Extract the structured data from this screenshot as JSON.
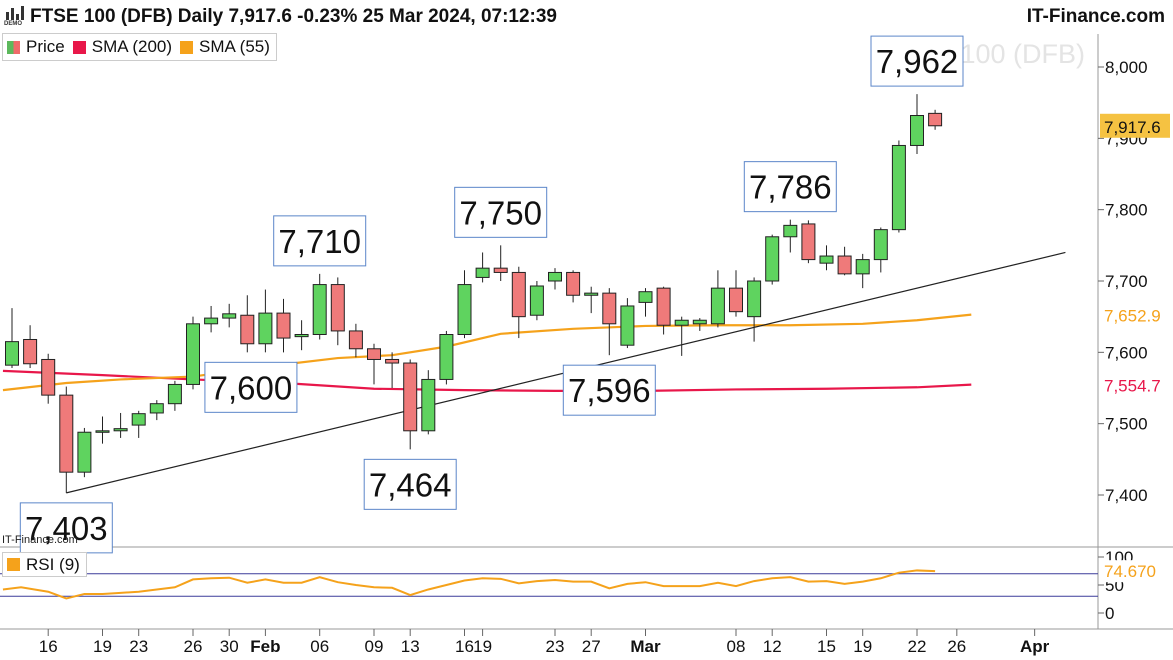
{
  "header": {
    "title": "FTSE 100 (DFB) Daily 7,917.6 -0.23% 25 Mar 2024, 07:12:39",
    "brand": "IT-Finance.com",
    "logo_text": "DEMO"
  },
  "legend": {
    "items": [
      {
        "label": "Price",
        "color": "#5cb85c"
      },
      {
        "label": "SMA (200)",
        "color": "#e8174a"
      },
      {
        "label": "SMA (55)",
        "color": "#f5a21b"
      }
    ]
  },
  "rsi_legend": {
    "label": "RSI (9)",
    "color": "#f5a21b"
  },
  "credit": "IT-Finance.com",
  "colors": {
    "up": "#5fd35f",
    "down": "#ef7a7a",
    "sma200": "#e8174a",
    "sma55": "#f5a21b",
    "rsi": "#f5a21b",
    "trend": "#222222",
    "box_border": "#5b86c9",
    "price_tag": "#f5c242"
  },
  "chart_data": [
    {
      "type": "candlestick",
      "title": "FTSE 100 (DFB)",
      "ylim": [
        7310,
        8050
      ],
      "y_ticks": [
        "7,400",
        "7,500",
        "7,600",
        "7,700",
        "7,800",
        "7,900",
        "8,000"
      ],
      "x_labels": [
        {
          "label": "16",
          "index": 2
        },
        {
          "label": "19",
          "index": 5
        },
        {
          "label": "23",
          "index": 7
        },
        {
          "label": "26",
          "index": 10
        },
        {
          "label": "30",
          "index": 12
        },
        {
          "label": "Feb",
          "index": 14
        },
        {
          "label": "06",
          "index": 17
        },
        {
          "label": "09",
          "index": 20
        },
        {
          "label": "13",
          "index": 22
        },
        {
          "label": "16",
          "index": 25
        },
        {
          "label": "19",
          "index": 26
        },
        {
          "label": "23",
          "index": 30
        },
        {
          "label": "27",
          "index": 32
        },
        {
          "label": "Mar",
          "index": 35
        },
        {
          "label": "08",
          "index": 40
        },
        {
          "label": "12",
          "index": 42
        },
        {
          "label": "15",
          "index": 45
        },
        {
          "label": "19",
          "index": 47
        },
        {
          "label": "22",
          "index": 50
        },
        {
          "label": "26",
          "index": 52.2
        },
        {
          "label": "Apr",
          "index": 56.5
        }
      ],
      "candles": [
        {
          "o": 7582,
          "h": 7662,
          "l": 7578,
          "c": 7615
        },
        {
          "o": 7618,
          "h": 7638,
          "l": 7578,
          "c": 7584
        },
        {
          "o": 7590,
          "h": 7598,
          "l": 7528,
          "c": 7540
        },
        {
          "o": 7540,
          "h": 7552,
          "l": 7403,
          "c": 7432
        },
        {
          "o": 7432,
          "h": 7494,
          "l": 7425,
          "c": 7488
        },
        {
          "o": 7488,
          "h": 7510,
          "l": 7472,
          "c": 7490
        },
        {
          "o": 7490,
          "h": 7515,
          "l": 7480,
          "c": 7493
        },
        {
          "o": 7498,
          "h": 7518,
          "l": 7480,
          "c": 7514
        },
        {
          "o": 7515,
          "h": 7533,
          "l": 7505,
          "c": 7528
        },
        {
          "o": 7528,
          "h": 7560,
          "l": 7518,
          "c": 7555
        },
        {
          "o": 7555,
          "h": 7650,
          "l": 7548,
          "c": 7640
        },
        {
          "o": 7640,
          "h": 7665,
          "l": 7628,
          "c": 7648
        },
        {
          "o": 7648,
          "h": 7668,
          "l": 7635,
          "c": 7654
        },
        {
          "o": 7652,
          "h": 7680,
          "l": 7600,
          "c": 7612
        },
        {
          "o": 7612,
          "h": 7688,
          "l": 7600,
          "c": 7655
        },
        {
          "o": 7655,
          "h": 7675,
          "l": 7600,
          "c": 7620
        },
        {
          "o": 7622,
          "h": 7645,
          "l": 7603,
          "c": 7625
        },
        {
          "o": 7625,
          "h": 7710,
          "l": 7618,
          "c": 7695
        },
        {
          "o": 7695,
          "h": 7705,
          "l": 7610,
          "c": 7630
        },
        {
          "o": 7630,
          "h": 7640,
          "l": 7593,
          "c": 7605
        },
        {
          "o": 7605,
          "h": 7612,
          "l": 7555,
          "c": 7590
        },
        {
          "o": 7590,
          "h": 7600,
          "l": 7550,
          "c": 7585
        },
        {
          "o": 7585,
          "h": 7590,
          "l": 7464,
          "c": 7490
        },
        {
          "o": 7490,
          "h": 7575,
          "l": 7485,
          "c": 7562
        },
        {
          "o": 7562,
          "h": 7630,
          "l": 7555,
          "c": 7625
        },
        {
          "o": 7625,
          "h": 7715,
          "l": 7620,
          "c": 7695
        },
        {
          "o": 7705,
          "h": 7740,
          "l": 7698,
          "c": 7718
        },
        {
          "o": 7718,
          "h": 7750,
          "l": 7700,
          "c": 7712
        },
        {
          "o": 7712,
          "h": 7720,
          "l": 7620,
          "c": 7650
        },
        {
          "o": 7652,
          "h": 7700,
          "l": 7645,
          "c": 7693
        },
        {
          "o": 7700,
          "h": 7718,
          "l": 7688,
          "c": 7712
        },
        {
          "o": 7712,
          "h": 7715,
          "l": 7670,
          "c": 7680
        },
        {
          "o": 7680,
          "h": 7692,
          "l": 7655,
          "c": 7683
        },
        {
          "o": 7683,
          "h": 7690,
          "l": 7596,
          "c": 7640
        },
        {
          "o": 7610,
          "h": 7676,
          "l": 7606,
          "c": 7665
        },
        {
          "o": 7670,
          "h": 7690,
          "l": 7650,
          "c": 7685
        },
        {
          "o": 7690,
          "h": 7692,
          "l": 7625,
          "c": 7638
        },
        {
          "o": 7638,
          "h": 7650,
          "l": 7595,
          "c": 7645
        },
        {
          "o": 7640,
          "h": 7648,
          "l": 7630,
          "c": 7645
        },
        {
          "o": 7640,
          "h": 7715,
          "l": 7635,
          "c": 7690
        },
        {
          "o": 7690,
          "h": 7715,
          "l": 7650,
          "c": 7657
        },
        {
          "o": 7650,
          "h": 7705,
          "l": 7615,
          "c": 7700
        },
        {
          "o": 7700,
          "h": 7765,
          "l": 7695,
          "c": 7762
        },
        {
          "o": 7762,
          "h": 7786,
          "l": 7740,
          "c": 7778
        },
        {
          "o": 7780,
          "h": 7785,
          "l": 7725,
          "c": 7730
        },
        {
          "o": 7725,
          "h": 7750,
          "l": 7715,
          "c": 7735
        },
        {
          "o": 7735,
          "h": 7748,
          "l": 7708,
          "c": 7710
        },
        {
          "o": 7710,
          "h": 7738,
          "l": 7690,
          "c": 7730
        },
        {
          "o": 7730,
          "h": 7775,
          "l": 7712,
          "c": 7772
        },
        {
          "o": 7772,
          "h": 7897,
          "l": 7768,
          "c": 7890
        },
        {
          "o": 7890,
          "h": 7962,
          "l": 7878,
          "c": 7932
        },
        {
          "o": 7935,
          "h": 7940,
          "l": 7912,
          "c": 7917.6
        }
      ],
      "sma200": [
        {
          "i": -0.5,
          "v": 7574
        },
        {
          "i": 5,
          "v": 7568
        },
        {
          "i": 10,
          "v": 7562
        },
        {
          "i": 15,
          "v": 7557
        },
        {
          "i": 20,
          "v": 7549
        },
        {
          "i": 25,
          "v": 7547
        },
        {
          "i": 30,
          "v": 7546
        },
        {
          "i": 35,
          "v": 7546
        },
        {
          "i": 40,
          "v": 7548
        },
        {
          "i": 45,
          "v": 7549
        },
        {
          "i": 50,
          "v": 7551
        },
        {
          "i": 53,
          "v": 7554.7
        }
      ],
      "sma55": [
        {
          "i": -0.5,
          "v": 7547
        },
        {
          "i": 3,
          "v": 7557
        },
        {
          "i": 6,
          "v": 7562
        },
        {
          "i": 10,
          "v": 7566
        },
        {
          "i": 14,
          "v": 7580
        },
        {
          "i": 18,
          "v": 7592
        },
        {
          "i": 21,
          "v": 7596
        },
        {
          "i": 24,
          "v": 7608
        },
        {
          "i": 27,
          "v": 7626
        },
        {
          "i": 31,
          "v": 7633
        },
        {
          "i": 35,
          "v": 7637
        },
        {
          "i": 39,
          "v": 7638
        },
        {
          "i": 43,
          "v": 7638
        },
        {
          "i": 47,
          "v": 7640
        },
        {
          "i": 50,
          "v": 7645
        },
        {
          "i": 53,
          "v": 7652.9
        }
      ],
      "trendline": [
        {
          "i": 3,
          "v": 7403
        },
        {
          "i": 58.2,
          "v": 7740
        }
      ],
      "annotations": [
        {
          "text": "7,403",
          "index": 3,
          "price": 7403,
          "pos": "below"
        },
        {
          "text": "7,600",
          "index": 13.2,
          "price": 7600,
          "pos": "below"
        },
        {
          "text": "7,710",
          "index": 17,
          "price": 7710,
          "pos": "above"
        },
        {
          "text": "7,464",
          "index": 22,
          "price": 7464,
          "pos": "below"
        },
        {
          "text": "7,750",
          "index": 27,
          "price": 7750,
          "pos": "above"
        },
        {
          "text": "7,596",
          "index": 33,
          "price": 7596,
          "pos": "below"
        },
        {
          "text": "7,786",
          "index": 43,
          "price": 7786,
          "pos": "above"
        },
        {
          "text": "7,962",
          "index": 50,
          "price": 7962,
          "pos": "above"
        }
      ],
      "last_price_label": "7,917.6",
      "sma55_label": "7,652.9",
      "sma200_label": "7,554.7",
      "watermark": "FTSE 100 (DFB)"
    },
    {
      "type": "line",
      "title": "RSI (9)",
      "ylim": [
        0,
        100
      ],
      "y_ticks": [
        "0",
        "50",
        "100"
      ],
      "levels": [
        30,
        70
      ],
      "last_label": "74.670",
      "values": [
        {
          "i": -0.5,
          "v": 42
        },
        {
          "i": 0.5,
          "v": 46
        },
        {
          "i": 2,
          "v": 38
        },
        {
          "i": 3,
          "v": 26
        },
        {
          "i": 4,
          "v": 34
        },
        {
          "i": 5,
          "v": 34
        },
        {
          "i": 6,
          "v": 36
        },
        {
          "i": 7,
          "v": 38
        },
        {
          "i": 8,
          "v": 42
        },
        {
          "i": 9,
          "v": 46
        },
        {
          "i": 10,
          "v": 60
        },
        {
          "i": 11,
          "v": 62
        },
        {
          "i": 12,
          "v": 63
        },
        {
          "i": 13,
          "v": 54
        },
        {
          "i": 14,
          "v": 60
        },
        {
          "i": 15,
          "v": 54
        },
        {
          "i": 16,
          "v": 54
        },
        {
          "i": 17,
          "v": 64
        },
        {
          "i": 18,
          "v": 55
        },
        {
          "i": 19,
          "v": 50
        },
        {
          "i": 20,
          "v": 46
        },
        {
          "i": 21,
          "v": 45
        },
        {
          "i": 22,
          "v": 32
        },
        {
          "i": 23,
          "v": 42
        },
        {
          "i": 24,
          "v": 50
        },
        {
          "i": 25,
          "v": 58
        },
        {
          "i": 26,
          "v": 62
        },
        {
          "i": 27,
          "v": 61
        },
        {
          "i": 28,
          "v": 53
        },
        {
          "i": 29,
          "v": 57
        },
        {
          "i": 30,
          "v": 59
        },
        {
          "i": 31,
          "v": 56
        },
        {
          "i": 32,
          "v": 56
        },
        {
          "i": 33,
          "v": 44
        },
        {
          "i": 34,
          "v": 52
        },
        {
          "i": 35,
          "v": 55
        },
        {
          "i": 36,
          "v": 48
        },
        {
          "i": 37,
          "v": 48
        },
        {
          "i": 38,
          "v": 48
        },
        {
          "i": 39,
          "v": 54
        },
        {
          "i": 40,
          "v": 48
        },
        {
          "i": 41,
          "v": 57
        },
        {
          "i": 42,
          "v": 62
        },
        {
          "i": 43,
          "v": 64
        },
        {
          "i": 44,
          "v": 56
        },
        {
          "i": 45,
          "v": 57
        },
        {
          "i": 46,
          "v": 52
        },
        {
          "i": 47,
          "v": 56
        },
        {
          "i": 48,
          "v": 62
        },
        {
          "i": 49,
          "v": 72
        },
        {
          "i": 50,
          "v": 76
        },
        {
          "i": 51,
          "v": 74.67
        }
      ]
    }
  ]
}
